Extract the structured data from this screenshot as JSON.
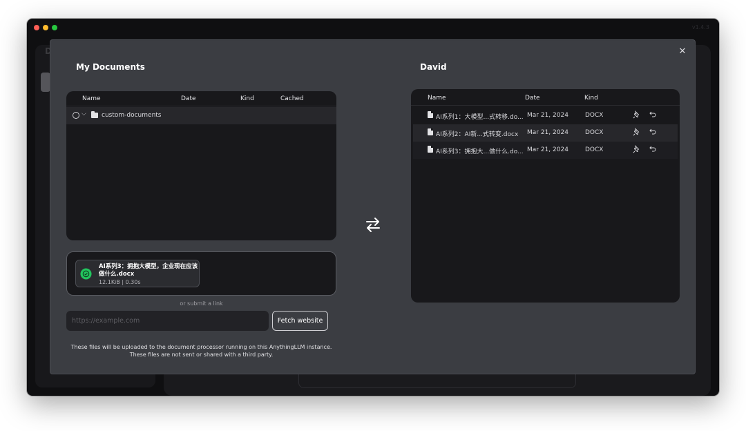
{
  "app": {
    "version_tag": "v1.4.3",
    "background_letter": "D"
  },
  "modal": {
    "left_title": "My Documents",
    "right_title": "David",
    "close_symbol": "✕"
  },
  "my_documents": {
    "columns": [
      "Name",
      "Date",
      "Kind",
      "Cached"
    ],
    "rows": [
      {
        "name": "custom-documents",
        "type": "folder"
      }
    ]
  },
  "workspace": {
    "columns": [
      "Name",
      "Date",
      "Kind"
    ],
    "rows": [
      {
        "name": "AI系列1：大模型...式转移.do...",
        "date": "Mar 21, 2024",
        "kind": "DOCX"
      },
      {
        "name": "AI系列2：AI新...式转变.docx",
        "date": "Mar 21, 2024",
        "kind": "DOCX"
      },
      {
        "name": "AI系列3：拥抱大...做什么.do...",
        "date": "Mar 21, 2024",
        "kind": "DOCX"
      }
    ],
    "row_icons": [
      "pin-icon",
      "undo-arrow-icon"
    ]
  },
  "upload": {
    "file_name": "AI系列3：拥抱大模型，企业现在应该做什么.docx",
    "meta": "12.1KiB | 0.30s",
    "status_color": "#22c55e"
  },
  "link": {
    "hint": "or submit a link",
    "placeholder": "https://example.com",
    "button_label": "Fetch website"
  },
  "footnote": {
    "line1": "These files will be uploaded to the document processor running on this AnythingLLM instance.",
    "line2": "These files are not sent or shared with a third party."
  },
  "colors": {
    "modal_bg": "#3b3d42",
    "panel_bg": "#18181b",
    "success": "#22c55e"
  }
}
